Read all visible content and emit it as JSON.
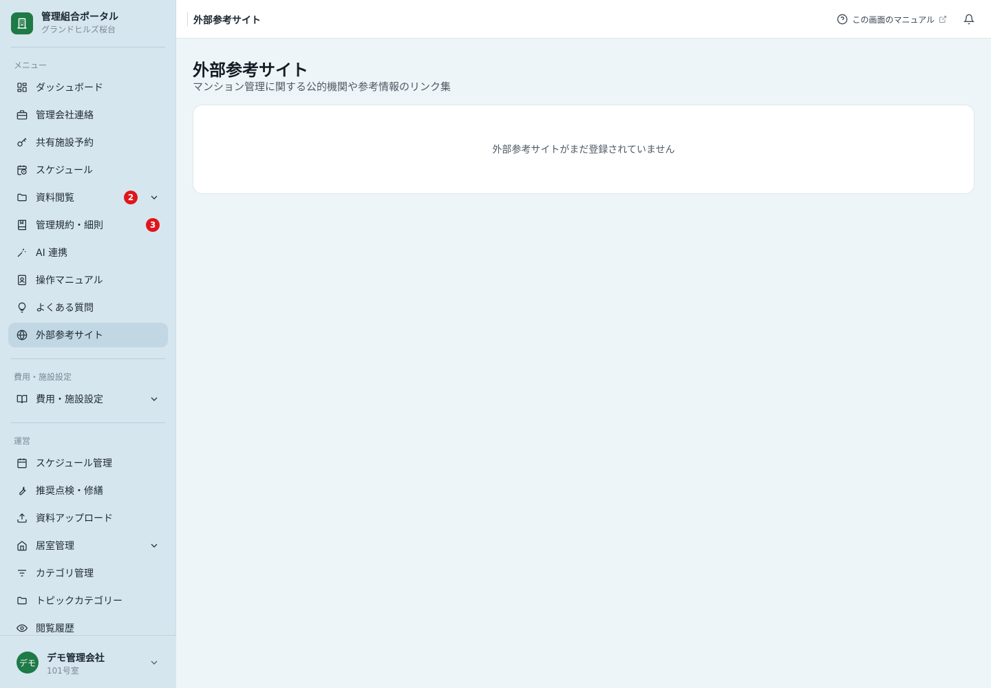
{
  "brand": {
    "title": "管理組合ポータル",
    "subtitle": "グランドヒルズ桜台"
  },
  "sidebar": {
    "sections": [
      {
        "label": "メニュー"
      },
      {
        "label": "費用・施設設定"
      },
      {
        "label": "運営"
      }
    ],
    "menu": [
      {
        "label": "ダッシュボード",
        "icon": "dashboard-grid-icon"
      },
      {
        "label": "管理会社連絡",
        "icon": "briefcase-icon"
      },
      {
        "label": "共有施設予約",
        "icon": "key-icon"
      },
      {
        "label": "スケジュール",
        "icon": "calendar-clock-icon"
      },
      {
        "label": "資料閲覧",
        "icon": "folder-icon",
        "badge": "2",
        "expandable": true
      },
      {
        "label": "管理規約・細則",
        "icon": "book-bookmark-icon",
        "badge": "3"
      },
      {
        "label": "AI 連携",
        "icon": "sparkles-wand-icon"
      },
      {
        "label": "操作マニュアル",
        "icon": "manual-book-icon"
      },
      {
        "label": "よくある質問",
        "icon": "lightbulb-icon"
      },
      {
        "label": "外部参考サイト",
        "icon": "globe-icon",
        "active": true
      }
    ],
    "settings": [
      {
        "label": "費用・施設設定",
        "icon": "open-book-icon",
        "expandable": true
      }
    ],
    "operations": [
      {
        "label": "スケジュール管理",
        "icon": "calendar-icon"
      },
      {
        "label": "推奨点検・修繕",
        "icon": "wrench-icon"
      },
      {
        "label": "資料アップロード",
        "icon": "upload-icon"
      },
      {
        "label": "居室管理",
        "icon": "home-icon",
        "expandable": true
      },
      {
        "label": "カテゴリ管理",
        "icon": "filter-lines-icon"
      },
      {
        "label": "トピックカテゴリー",
        "icon": "folder-icon"
      },
      {
        "label": "閲覧履歴",
        "icon": "eye-icon"
      }
    ]
  },
  "user": {
    "avatar": "デモ",
    "name": "デモ管理会社",
    "room": "101号室"
  },
  "header": {
    "title": "外部参考サイト",
    "manual_link": "この画面のマニュアル"
  },
  "main": {
    "title": "外部参考サイト",
    "description": "マンション管理に関する公的機関や参考情報のリンク集",
    "empty_message": "外部参考サイトがまだ登録されていません"
  },
  "colors": {
    "accent": "#1e7a46",
    "badge": "#e0161c",
    "sidebar_bg": "#d6e6ef",
    "active_bg": "#c1d7e4"
  }
}
